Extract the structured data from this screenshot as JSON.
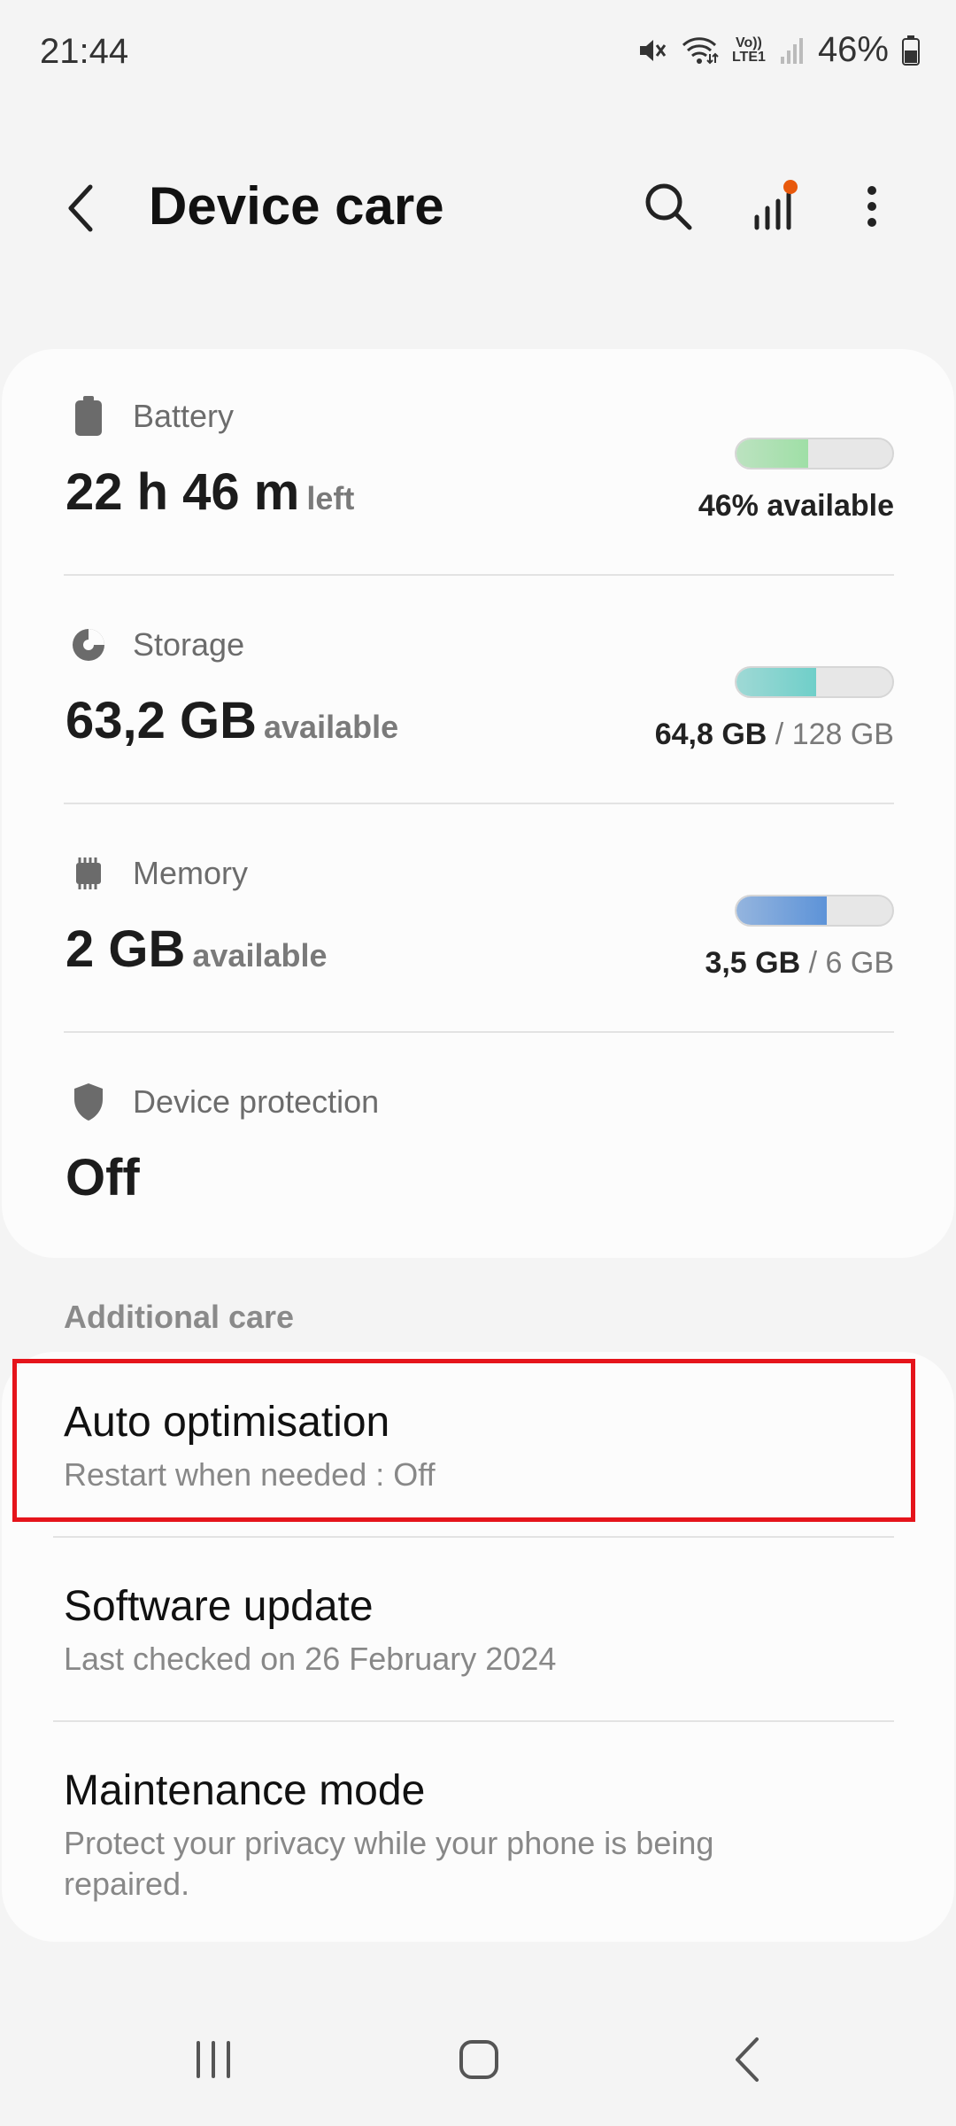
{
  "status_bar": {
    "time": "21:44",
    "battery_percent": "46%",
    "network_label": "Vo)) LTE1",
    "icons": [
      "mute-icon",
      "wifi-icon",
      "lte-icon",
      "signal-icon",
      "battery-icon"
    ]
  },
  "app_bar": {
    "title": "Device care",
    "icons": [
      "back-icon",
      "search-icon",
      "stats-icon",
      "more-icon"
    ],
    "notification_dot_color": "#e8590c"
  },
  "status_card": {
    "battery": {
      "label": "Battery",
      "value": "22 h 46 m",
      "unit": "left",
      "detail": "46% available",
      "fill_percent": 46,
      "bar_color": "#9fdfa6"
    },
    "storage": {
      "label": "Storage",
      "value": "63,2 GB",
      "unit": "available",
      "detail_used": "64,8 GB",
      "detail_total": "/ 128 GB",
      "fill_percent": 51,
      "bar_color": "#6fcfc9"
    },
    "memory": {
      "label": "Memory",
      "value": "2 GB",
      "unit": "available",
      "detail_used": "3,5 GB",
      "detail_total": "/ 6 GB",
      "fill_percent": 58,
      "bar_color": "#5d93d8"
    },
    "device_protection": {
      "label": "Device protection",
      "value": "Off"
    }
  },
  "additional_care": {
    "section_label": "Additional care",
    "items": [
      {
        "title": "Auto optimisation",
        "subtitle": "Restart when needed : Off"
      },
      {
        "title": "Software update",
        "subtitle": "Last checked on 26 February 2024"
      },
      {
        "title": "Maintenance mode",
        "subtitle": "Protect your privacy while your phone is being repaired."
      }
    ]
  },
  "navigation_bar": {
    "icons": [
      "recents-icon",
      "home-icon",
      "back-nav-icon"
    ]
  }
}
